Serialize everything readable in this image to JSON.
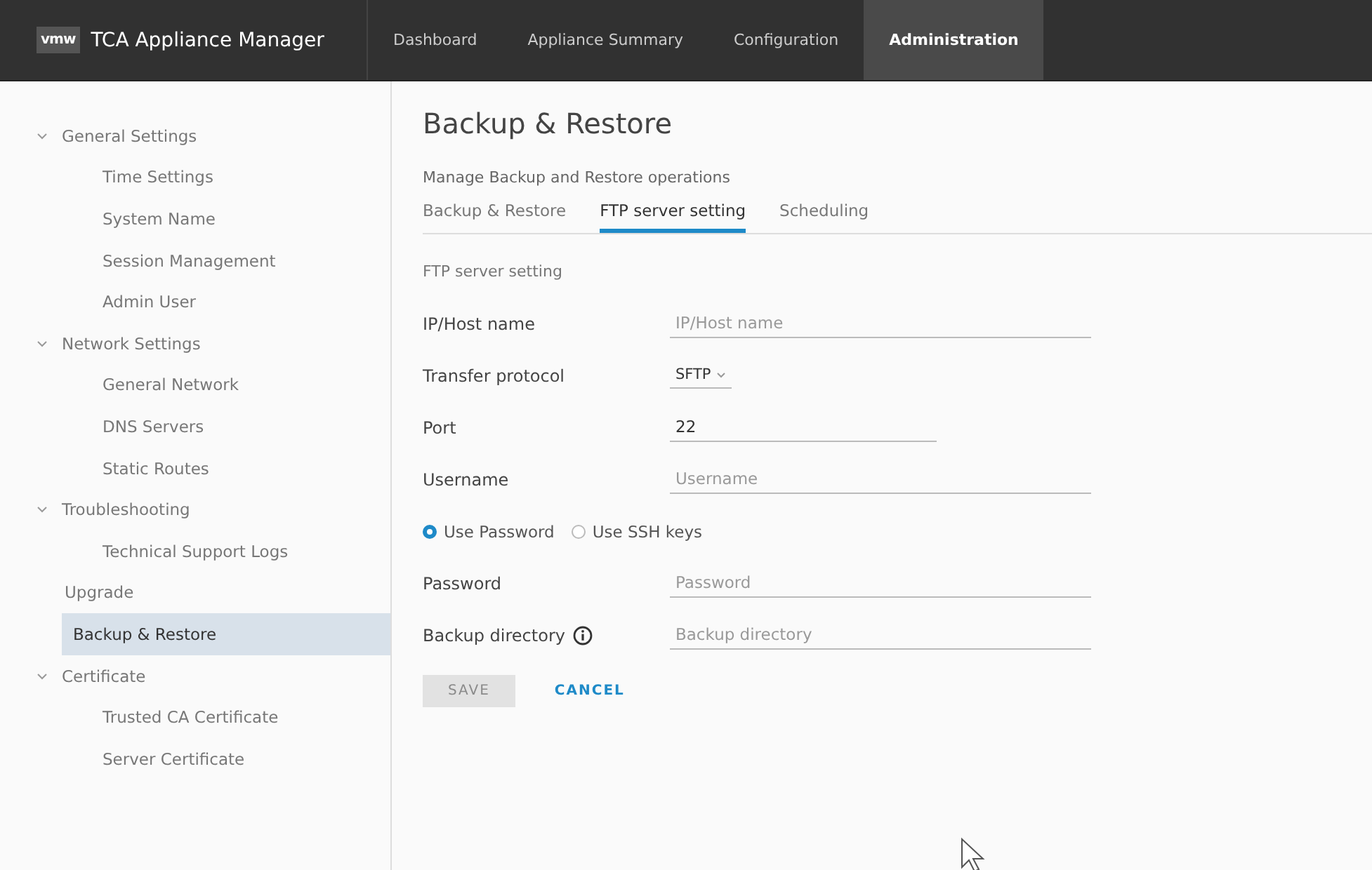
{
  "header": {
    "logo": "vmw",
    "title": "TCA Appliance Manager",
    "nav": [
      {
        "label": "Dashboard",
        "selected": false
      },
      {
        "label": "Appliance Summary",
        "selected": false
      },
      {
        "label": "Configuration",
        "selected": false
      },
      {
        "label": "Administration",
        "selected": true
      }
    ]
  },
  "sidebar": {
    "items": [
      {
        "label": "General Settings",
        "expanded": true,
        "selected": false,
        "children": [
          {
            "label": "Time Settings",
            "selected": false
          },
          {
            "label": "System Name",
            "selected": false
          },
          {
            "label": "Session Management",
            "selected": false
          },
          {
            "label": "Admin User",
            "selected": false
          }
        ]
      },
      {
        "label": "Network Settings",
        "expanded": true,
        "selected": false,
        "children": [
          {
            "label": "General Network",
            "selected": false
          },
          {
            "label": "DNS Servers",
            "selected": false
          },
          {
            "label": "Static Routes",
            "selected": false
          }
        ]
      },
      {
        "label": "Troubleshooting",
        "expanded": true,
        "selected": false,
        "children": [
          {
            "label": "Technical Support Logs",
            "selected": false
          }
        ]
      },
      {
        "label": "Upgrade",
        "selected": false
      },
      {
        "label": "Backup & Restore",
        "selected": true
      },
      {
        "label": "Certificate",
        "expanded": true,
        "selected": false,
        "children": [
          {
            "label": "Trusted CA Certificate",
            "selected": false
          },
          {
            "label": "Server Certificate",
            "selected": false
          }
        ]
      }
    ]
  },
  "page": {
    "title": "Backup & Restore",
    "subtitle": "Manage Backup and Restore operations",
    "tabs": [
      {
        "label": "Backup & Restore",
        "selected": false
      },
      {
        "label": "FTP server setting",
        "selected": true
      },
      {
        "label": "Scheduling",
        "selected": false
      }
    ],
    "section": "FTP server setting",
    "fields": [
      {
        "kind": "text",
        "label": "IP/Host name",
        "placeholder": "IP/Host name"
      },
      {
        "kind": "select",
        "label": "Transfer protocol",
        "value": "SFTP"
      },
      {
        "kind": "short",
        "label": "Port",
        "value": "22"
      },
      {
        "kind": "text",
        "label": "Username",
        "placeholder": "Username"
      },
      {
        "kind": "radios",
        "options": [
          {
            "label": "Use Password",
            "selected": true
          },
          {
            "label": "Use SSH keys",
            "selected": false
          }
        ]
      },
      {
        "kind": "text",
        "label": "Password",
        "placeholder": "Password"
      },
      {
        "kind": "text",
        "label": "Backup directory",
        "info": true,
        "placeholder": "Backup directory"
      }
    ],
    "buttons": [
      {
        "kind": "primary",
        "label": "SAVE",
        "disabled": true
      },
      {
        "kind": "link",
        "label": "CANCEL",
        "disabled": false
      }
    ]
  }
}
